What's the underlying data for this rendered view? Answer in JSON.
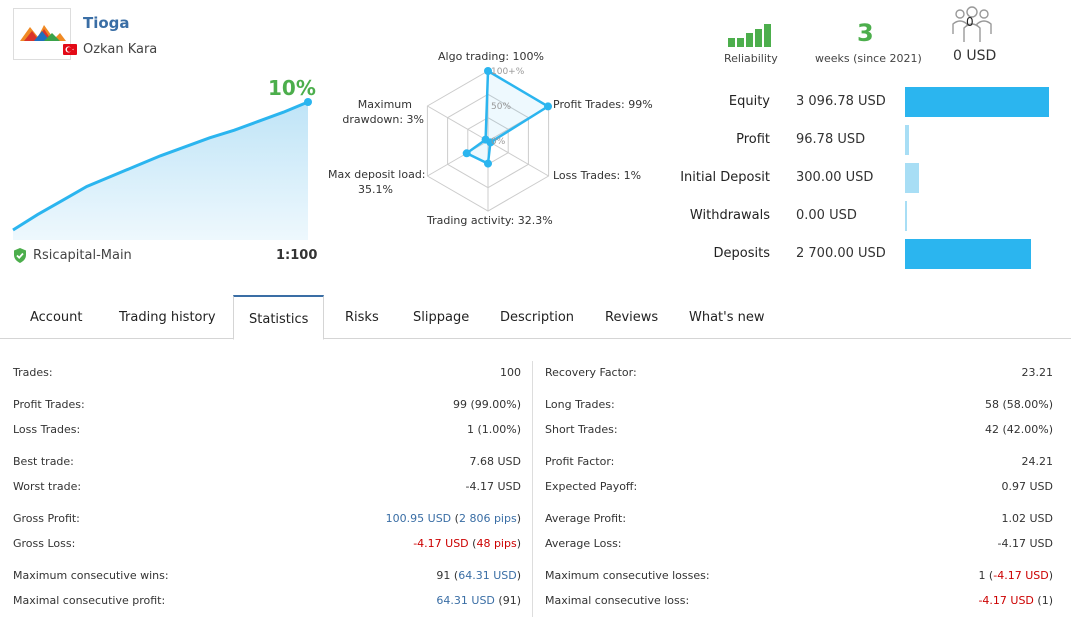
{
  "provider": {
    "name": "Tioga",
    "owner": "Ozkan Kara",
    "country_flag": "tr-flag-icon"
  },
  "growth": {
    "percent": "10%",
    "server": "Rsicapital-Main",
    "leverage": "1:100",
    "series": [
      0,
      1.2,
      2.3,
      3.4,
      4.2,
      5.0,
      5.8,
      6.5,
      7.2,
      7.8,
      8.5,
      9.2,
      10.0
    ]
  },
  "radar": {
    "algo": "Algo trading: 100%",
    "profit_trades": "Profit Trades: 99%",
    "loss_trades": "Loss Trades: 1%",
    "activity": "Trading activity: 32.3%",
    "deposit_load_1": "Max deposit load:",
    "deposit_load_2": "35.1%",
    "drawdown_1": "Maximum",
    "drawdown_2": "drawdown: 3%",
    "scale_100": "100+%",
    "scale_50": "50%",
    "scale_0": "0%",
    "values": {
      "algo": 100,
      "profit_trades": 99,
      "loss_trades": 1,
      "activity": 32.3,
      "deposit_load": 35.1,
      "drawdown": 3
    }
  },
  "reliability": {
    "label": "Reliability",
    "bars": [
      2,
      2,
      3,
      4,
      5
    ]
  },
  "weeks": {
    "count": "3",
    "label": "weeks (since 2021)"
  },
  "subscribers": {
    "count": "0",
    "price": "0 USD"
  },
  "balances": [
    {
      "label": "Equity",
      "value": "3 096.78 USD",
      "fraction": 1.0,
      "color": "#2bb5ef"
    },
    {
      "label": "Profit",
      "value": "96.78 USD",
      "fraction": 0.031,
      "color": "#a8def5"
    },
    {
      "label": "Initial Deposit",
      "value": "300.00 USD",
      "fraction": 0.097,
      "color": "#a8def5"
    },
    {
      "label": "Withdrawals",
      "value": "0.00 USD",
      "fraction": 0.0,
      "color": "#a8def5"
    },
    {
      "label": "Deposits",
      "value": "2 700.00 USD",
      "fraction": 0.872,
      "color": "#2bb5ef"
    }
  ],
  "tabs": [
    "Account",
    "Trading history",
    "Statistics",
    "Risks",
    "Slippage",
    "Description",
    "Reviews",
    "What's new"
  ],
  "active_tab": "Statistics",
  "stats_left": [
    {
      "k": "Trades:",
      "v": "100"
    },
    {
      "k": "Profit Trades:",
      "v": "99 (99.00%)"
    },
    {
      "k": "Loss Trades:",
      "v": "1 (1.00%)"
    },
    {
      "k": "Best trade:",
      "v": "7.68 USD"
    },
    {
      "k": "Worst trade:",
      "v": "-4.17 USD"
    },
    {
      "k": "Gross Profit:",
      "v1": "100.95 USD",
      "v2": "2 806 pips"
    },
    {
      "k": "Gross Loss:",
      "v1": "-4.17 USD",
      "v2": "48 pips"
    },
    {
      "k": "Maximum consecutive wins:",
      "v1": "91",
      "v2": "64.31 USD"
    },
    {
      "k": "Maximal consecutive profit:",
      "v1": "64.31 USD",
      "v2": "91"
    }
  ],
  "stats_right": [
    {
      "k": "Recovery Factor:",
      "v": "23.21"
    },
    {
      "k": "Long Trades:",
      "v": "58 (58.00%)"
    },
    {
      "k": "Short Trades:",
      "v": "42 (42.00%)"
    },
    {
      "k": "Profit Factor:",
      "v": "24.21"
    },
    {
      "k": "Expected Payoff:",
      "v": "0.97 USD"
    },
    {
      "k": "Average Profit:",
      "v": "1.02 USD"
    },
    {
      "k": "Average Loss:",
      "v": "-4.17 USD"
    },
    {
      "k": "Maximum consecutive losses:",
      "v1": "1",
      "v2": "-4.17 USD"
    },
    {
      "k": "Maximal consecutive loss:",
      "v1": "-4.17 USD",
      "v2": "1"
    }
  ]
}
